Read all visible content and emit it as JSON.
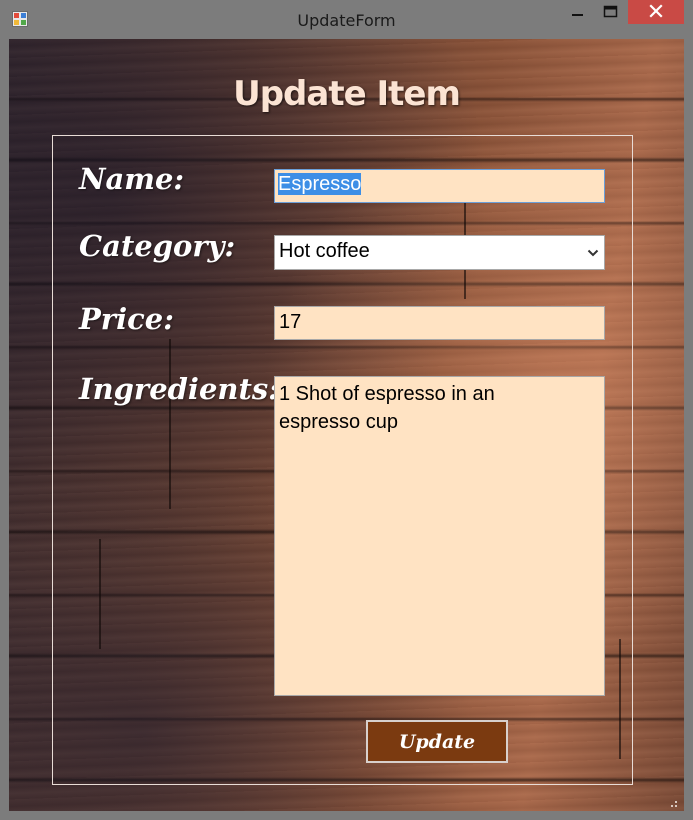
{
  "window": {
    "title": "UpdateForm"
  },
  "form": {
    "heading": "Update Item",
    "name_label": "Name:",
    "name_value": "Espresso",
    "category_label": "Category:",
    "category_value": "Hot coffee",
    "price_label": "Price:",
    "price_value": "17",
    "ingredients_label": "Ingredients:",
    "ingredients_value": "1 Shot of espresso in an\nespresso cup",
    "update_label": "Update"
  },
  "colors": {
    "field_background": "#ffe3c3",
    "button_background": "#7b3a10",
    "selection": "#3d8ee6",
    "close_button": "#c94a45"
  },
  "icons": {
    "app": "app-icon",
    "minimize": "minimize-icon",
    "maximize": "maximize-icon",
    "close": "close-icon",
    "dropdown": "chevron-down-icon"
  }
}
